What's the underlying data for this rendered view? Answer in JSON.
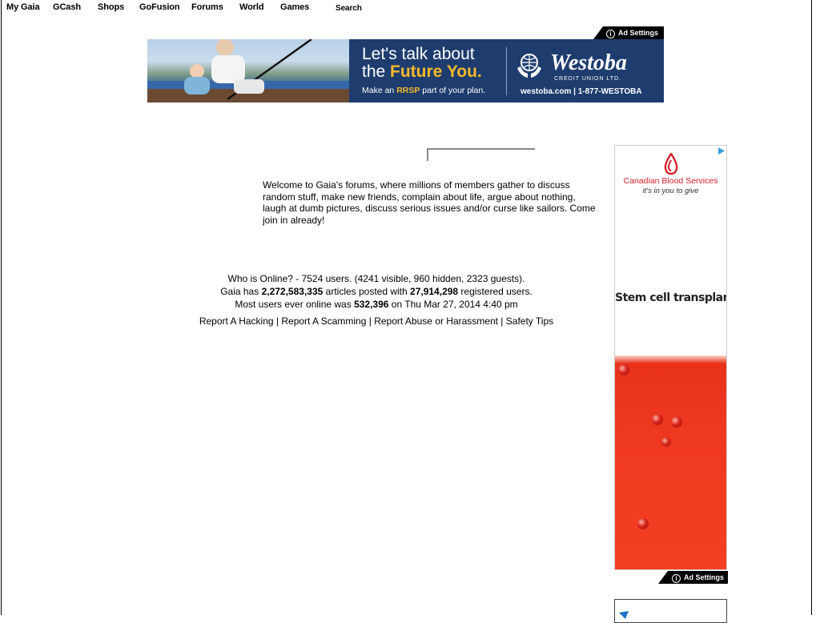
{
  "nav": {
    "items": [
      "My Gaia",
      "GCash",
      "Shops",
      "GoFusion",
      "Forums",
      "World",
      "Games"
    ],
    "search_label": "Search"
  },
  "top_ad": {
    "ad_settings_label": "Ad Settings",
    "headline_line1": "Let's talk about",
    "headline_line2_prefix": "the ",
    "headline_line2_highlight": "Future You.",
    "subline_prefix": "Make an ",
    "subline_highlight": "RRSP",
    "subline_suffix": " part of your plan.",
    "brand": "Westoba",
    "brand_sub": "CREDIT UNION LTD.",
    "contact": "westoba.com  |  1-877-WESTOBA",
    "colors": {
      "panel": "#1e3d6e",
      "highlight": "#f5b82a"
    }
  },
  "welcome_text": "Welcome to Gaia's forums, where millions of members gather to discuss random stuff, make new friends, complain about life, argue about nothing, laugh at dumb pictures, discuss serious issues and/or curse like sailors. Come join in already!",
  "stats": {
    "online_line": "Who is Online? - 7524 users. (4241 visible, 960 hidden, 2323 guests).",
    "articles_prefix": "Gaia has ",
    "articles_count": "2,272,583,335",
    "articles_mid": " articles posted with ",
    "registered_count": "27,914,298",
    "articles_suffix": " registered users.",
    "record_prefix": "Most users ever online was ",
    "record_count": "532,396",
    "record_suffix": " on Thu Mar 27, 2014 4:40 pm"
  },
  "report_links": [
    "Report A Hacking",
    "Report A Scamming",
    "Report Abuse or Harassment",
    "Safety Tips"
  ],
  "side_ad": {
    "org": "Canadian Blood Services",
    "tagline": "it's in you to give",
    "headline": "Stem cell transplant.",
    "ad_settings_label": "Ad Settings",
    "colors": {
      "brand_red": "#d3202a",
      "liquid": "#f23c22"
    }
  }
}
